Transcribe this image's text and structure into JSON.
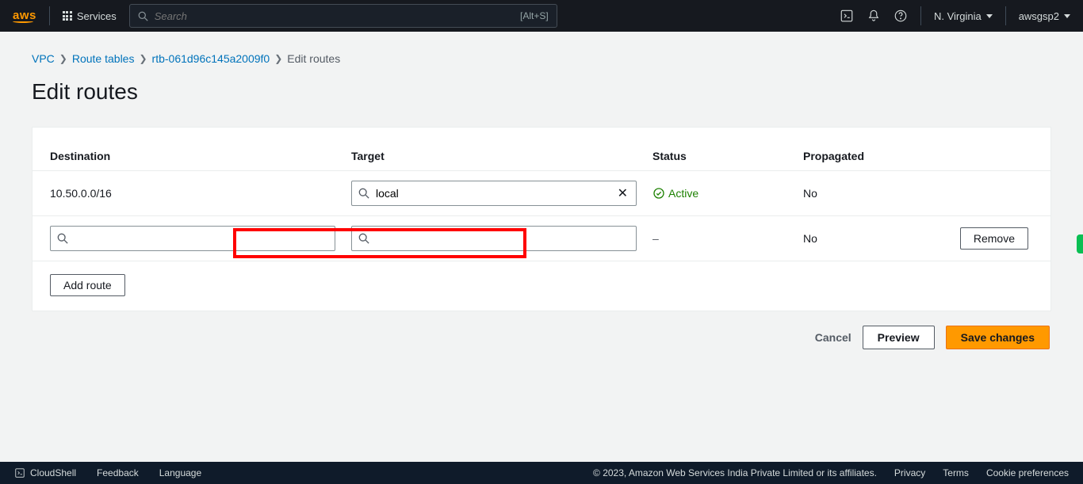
{
  "nav": {
    "logo": "aws",
    "services_label": "Services",
    "search_placeholder": "Search",
    "search_shortcut": "[Alt+S]",
    "region": "N. Virginia",
    "account": "awsgsp2"
  },
  "breadcrumb": {
    "items": [
      "VPC",
      "Route tables",
      "rtb-061d96c145a2009f0"
    ],
    "current": "Edit routes"
  },
  "page_title": "Edit routes",
  "table": {
    "headers": {
      "destination": "Destination",
      "target": "Target",
      "status": "Status",
      "propagated": "Propagated"
    },
    "rows": [
      {
        "destination": "10.50.0.0/16",
        "target_value": "local",
        "status": "Active",
        "status_kind": "active",
        "propagated": "No",
        "removable": false
      },
      {
        "destination": "",
        "target_value": "",
        "status": "–",
        "status_kind": "dash",
        "propagated": "No",
        "removable": true
      }
    ],
    "add_route_label": "Add route",
    "remove_label": "Remove"
  },
  "actions": {
    "cancel": "Cancel",
    "preview": "Preview",
    "save": "Save changes"
  },
  "footer": {
    "cloudshell": "CloudShell",
    "feedback": "Feedback",
    "language": "Language",
    "copyright": "© 2023, Amazon Web Services India Private Limited or its affiliates.",
    "privacy": "Privacy",
    "terms": "Terms",
    "cookies": "Cookie preferences"
  }
}
